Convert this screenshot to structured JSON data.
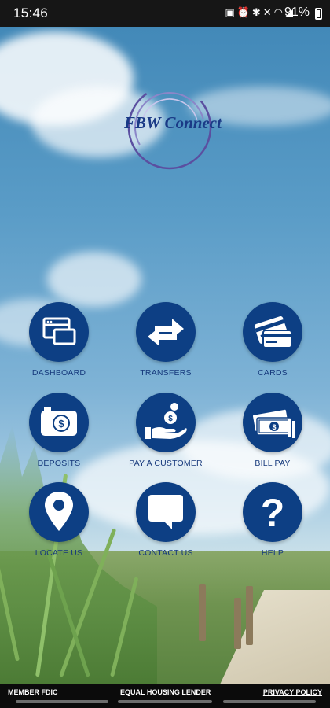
{
  "status_bar": {
    "time": "15:46",
    "icons": [
      "save-icon",
      "alarm-icon",
      "bluetooth-icon",
      "mute-icon",
      "wifi-icon",
      "signal-icon"
    ],
    "battery_percent": "91%"
  },
  "logo": {
    "text": "FBW Connect",
    "color": "#1a3a86"
  },
  "menu": {
    "accent_color": "#0d3f84",
    "items": [
      {
        "label": "DASHBOARD",
        "icon": "dashboard-window-icon"
      },
      {
        "label": "TRANSFERS",
        "icon": "transfer-arrows-icon"
      },
      {
        "label": "CARDS",
        "icon": "credit-cards-icon"
      },
      {
        "label": "DEPOSITS",
        "icon": "camera-check-deposit-icon"
      },
      {
        "label": "PAY A CUSTOMER",
        "icon": "hand-coins-icon"
      },
      {
        "label": "BILL PAY",
        "icon": "cash-stack-icon"
      },
      {
        "label": "LOCATE US",
        "icon": "map-pin-icon"
      },
      {
        "label": "CONTACT US",
        "icon": "chat-bubble-icon"
      },
      {
        "label": "HELP",
        "icon": "question-mark-icon"
      }
    ]
  },
  "footer": {
    "left": "MEMBER FDIC",
    "middle": "EQUAL HOUSING LENDER",
    "right": "PRIVACY POLICY"
  }
}
